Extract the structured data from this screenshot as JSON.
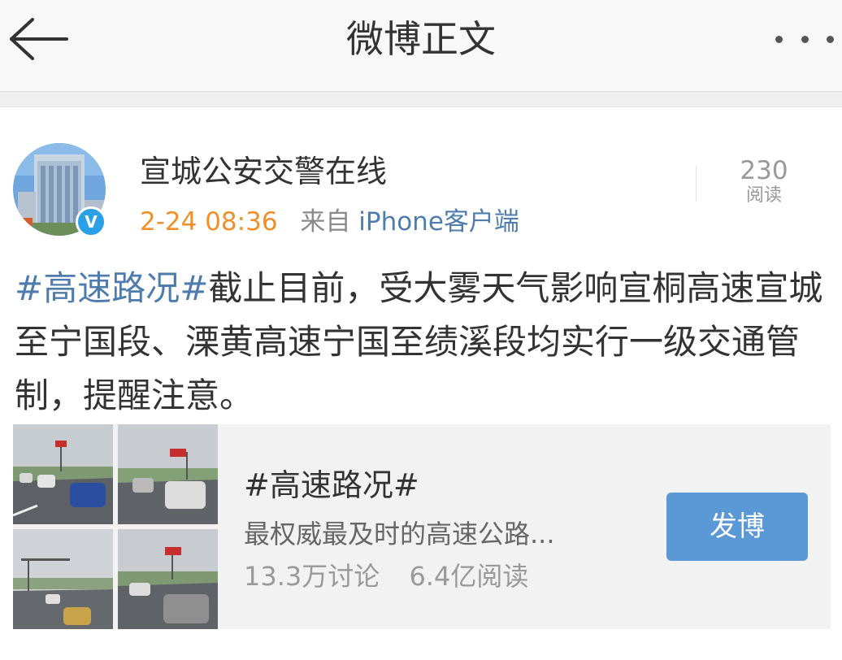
{
  "navbar": {
    "back_icon": "arrow-left-icon",
    "title": "微博正文",
    "more_icon": "more-dots-icon"
  },
  "post": {
    "author": "宣城公安交警在线",
    "verified_icon": "verified-v-icon",
    "time": "2-24 08:36",
    "from_prefix": "来自",
    "client": "iPhone客户端",
    "read_count": "230",
    "read_label": "阅读",
    "hashtag": "#高速路况#",
    "text": "截止目前，受大雾天气影响宣桐高速宣城至宁国段、溧黄高速宁国至绩溪段均实行一级交通管制，提醒注意。"
  },
  "topic_card": {
    "title": "#高速路况#",
    "description": "最权威最及时的高速公路...",
    "discussions": "13.3万讨论",
    "reads": "6.4亿阅读",
    "button_label": "发博"
  },
  "colors": {
    "link_blue": "#4f7cae",
    "time_orange": "#f0902a",
    "button_blue": "#5a98d6",
    "verified_blue": "#2aa1e6"
  }
}
